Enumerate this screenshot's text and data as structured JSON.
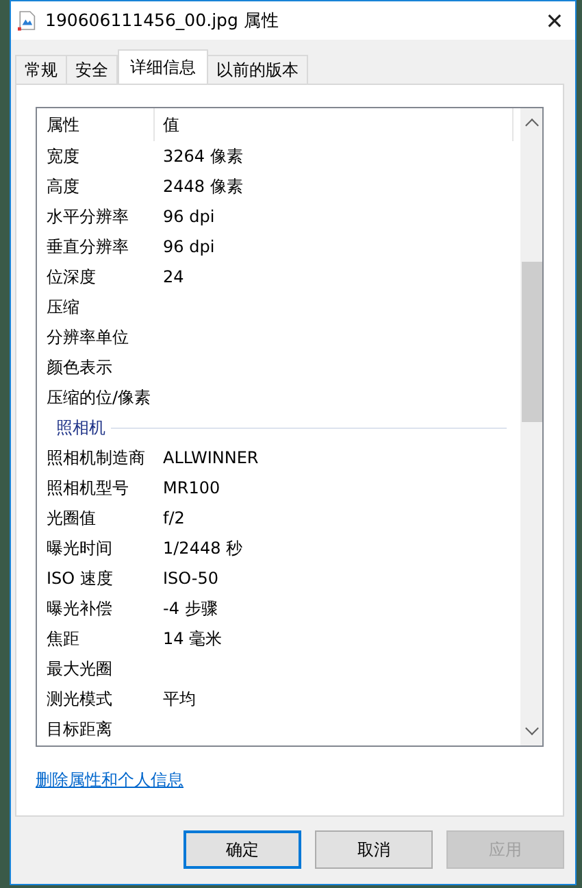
{
  "window": {
    "title": "190606111456_00.jpg 属性",
    "close": "✕"
  },
  "tabs": [
    {
      "label": "常规",
      "selected": false
    },
    {
      "label": "安全",
      "selected": false
    },
    {
      "label": "详细信息",
      "selected": true
    },
    {
      "label": "以前的版本",
      "selected": false
    }
  ],
  "table": {
    "columns": [
      "属性",
      "值"
    ],
    "rows": [
      {
        "kind": "row",
        "name": "宽度",
        "value": "3264 像素"
      },
      {
        "kind": "row",
        "name": "高度",
        "value": "2448 像素"
      },
      {
        "kind": "row",
        "name": "水平分辨率",
        "value": "96 dpi"
      },
      {
        "kind": "row",
        "name": "垂直分辨率",
        "value": "96 dpi"
      },
      {
        "kind": "row",
        "name": "位深度",
        "value": "24"
      },
      {
        "kind": "row",
        "name": "压缩"
      },
      {
        "kind": "row",
        "name": "分辨率单位"
      },
      {
        "kind": "row",
        "name": "颜色表示"
      },
      {
        "kind": "row",
        "name": "压缩的位/像素"
      },
      {
        "kind": "group",
        "name": "照相机"
      },
      {
        "kind": "row",
        "name": "照相机制造商",
        "value": "ALLWINNER"
      },
      {
        "kind": "row",
        "name": "照相机型号",
        "value": "MR100"
      },
      {
        "kind": "row",
        "name": "光圈值",
        "value": "f/2"
      },
      {
        "kind": "row",
        "name": "曝光时间",
        "value": "1/2448 秒"
      },
      {
        "kind": "row",
        "name": "ISO 速度",
        "value": "ISO-50"
      },
      {
        "kind": "row",
        "name": "曝光补偿",
        "value": "-4 步骤"
      },
      {
        "kind": "row",
        "name": "焦距",
        "value": "14 毫米"
      },
      {
        "kind": "row",
        "name": "最大光圈"
      },
      {
        "kind": "row",
        "name": "测光模式",
        "value": "平均"
      },
      {
        "kind": "row",
        "name": "目标距离"
      }
    ]
  },
  "link": "删除属性和个人信息",
  "buttons": [
    {
      "label": "确定",
      "default": true,
      "disabled": false
    },
    {
      "label": "取消",
      "default": false,
      "disabled": false
    },
    {
      "label": "应用",
      "default": false,
      "disabled": true
    }
  ]
}
